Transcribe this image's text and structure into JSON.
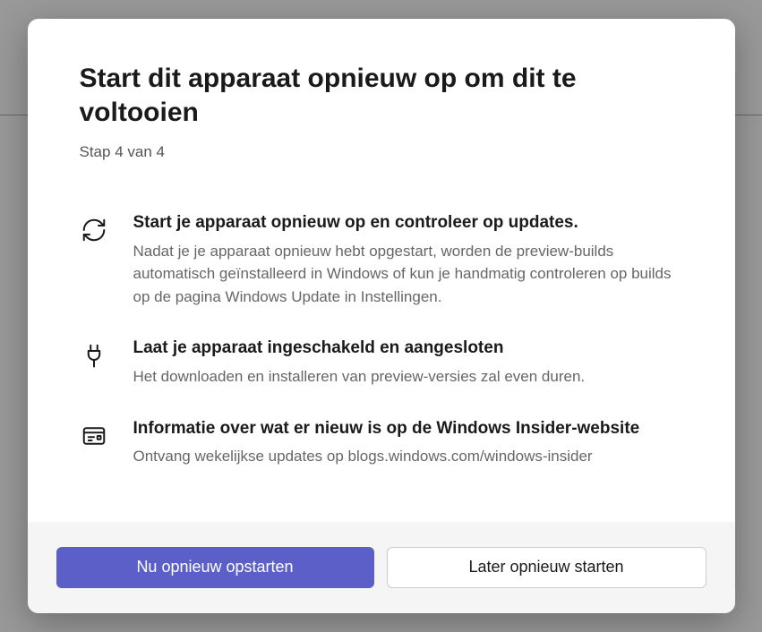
{
  "dialog": {
    "title": "Start dit apparaat opnieuw op om dit te voltooien",
    "step": "Stap 4 van 4"
  },
  "items": [
    {
      "title": "Start je apparaat opnieuw op en controleer op updates.",
      "desc": "Nadat je je apparaat opnieuw hebt opgestart, worden de preview-builds automatisch geïnstalleerd in Windows of kun je handmatig controleren op builds op de pagina Windows Update in Instellingen."
    },
    {
      "title": "Laat je apparaat ingeschakeld en aangesloten",
      "desc": "Het downloaden en installeren van preview-versies zal even duren."
    },
    {
      "title": "Informatie over wat er nieuw is op de Windows Insider-website",
      "desc": "Ontvang wekelijkse updates op blogs.windows.com/windows-insider"
    }
  ],
  "buttons": {
    "primary": "Nu opnieuw opstarten",
    "secondary": "Later opnieuw starten"
  }
}
